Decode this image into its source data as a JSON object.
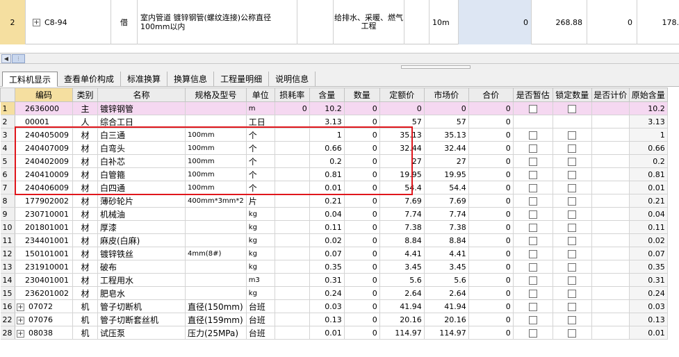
{
  "top_row": {
    "row_no": "2",
    "code": "C8-94",
    "type": "借",
    "name": "室内管道 镀锌钢管(螺纹连接)公称直径100mm以内",
    "major": "给排水、采暖、燃气工程",
    "unit": "10m",
    "quantity": "0",
    "unit_price": "268.88",
    "total": "0",
    "rest": "178."
  },
  "splitter_grip": "⁘",
  "tabs": [
    {
      "label": "工料机显示",
      "active": true
    },
    {
      "label": "查看单价构成"
    },
    {
      "label": "标准换算"
    },
    {
      "label": "换算信息"
    },
    {
      "label": "工程量明细"
    },
    {
      "label": "说明信息"
    }
  ],
  "columns": [
    "编码",
    "类别",
    "名称",
    "规格及型号",
    "单位",
    "损耗率",
    "含量",
    "数量",
    "定额价",
    "市场价",
    "合价",
    "是否暂估",
    "锁定数量",
    "是否计价",
    "原始含量"
  ],
  "rows": [
    {
      "no": "1",
      "code": "2636000",
      "cat": "主",
      "name": "镀锌钢管",
      "spec": "",
      "unit": "m",
      "loss": "0",
      "content": "10.2",
      "qty": "0",
      "price": "0",
      "market": "0",
      "sum": "0",
      "est": false,
      "lock": false,
      "orig": "10.2"
    },
    {
      "no": "2",
      "code": "00001",
      "cat": "人",
      "name": "综合工日",
      "spec": "",
      "unit": "工日",
      "loss": "",
      "content": "3.13",
      "qty": "0",
      "price": "57",
      "market": "57",
      "sum": "0",
      "est": null,
      "lock": null,
      "orig": "3.13"
    },
    {
      "no": "3",
      "code": "240405009",
      "cat": "材",
      "name": "白三通",
      "spec": "100mm",
      "unit": "个",
      "loss": "",
      "content": "1",
      "qty": "0",
      "price": "35.13",
      "market": "35.13",
      "sum": "0",
      "est": false,
      "lock": false,
      "orig": "1"
    },
    {
      "no": "4",
      "code": "240407009",
      "cat": "材",
      "name": "白弯头",
      "spec": "100mm",
      "unit": "个",
      "loss": "",
      "content": "0.66",
      "qty": "0",
      "price": "32.44",
      "market": "32.44",
      "sum": "0",
      "est": false,
      "lock": false,
      "orig": "0.66"
    },
    {
      "no": "5",
      "code": "240402009",
      "cat": "材",
      "name": "白补芯",
      "spec": "100mm",
      "unit": "个",
      "loss": "",
      "content": "0.2",
      "qty": "0",
      "price": "27",
      "market": "27",
      "sum": "0",
      "est": false,
      "lock": false,
      "orig": "0.2"
    },
    {
      "no": "6",
      "code": "240410009",
      "cat": "材",
      "name": "白管箍",
      "spec": "100mm",
      "unit": "个",
      "loss": "",
      "content": "0.81",
      "qty": "0",
      "price": "19.95",
      "market": "19.95",
      "sum": "0",
      "est": false,
      "lock": false,
      "orig": "0.81"
    },
    {
      "no": "7",
      "code": "240406009",
      "cat": "材",
      "name": "白四通",
      "spec": "100mm",
      "unit": "个",
      "loss": "",
      "content": "0.01",
      "qty": "0",
      "price": "54.4",
      "market": "54.4",
      "sum": "0",
      "est": false,
      "lock": false,
      "orig": "0.01"
    },
    {
      "no": "8",
      "code": "177902002",
      "cat": "材",
      "name": "薄砂轮片",
      "spec": "400mm*3mm*2",
      "unit": "片",
      "loss": "",
      "content": "0.21",
      "qty": "0",
      "price": "7.69",
      "market": "7.69",
      "sum": "0",
      "est": false,
      "lock": false,
      "orig": "0.21"
    },
    {
      "no": "9",
      "code": "230710001",
      "cat": "材",
      "name": "机械油",
      "spec": "",
      "unit": "kg",
      "loss": "",
      "content": "0.04",
      "qty": "0",
      "price": "7.74",
      "market": "7.74",
      "sum": "0",
      "est": false,
      "lock": false,
      "orig": "0.04"
    },
    {
      "no": "10",
      "code": "201801001",
      "cat": "材",
      "name": "厚漆",
      "spec": "",
      "unit": "kg",
      "loss": "",
      "content": "0.11",
      "qty": "0",
      "price": "7.38",
      "market": "7.38",
      "sum": "0",
      "est": false,
      "lock": false,
      "orig": "0.11"
    },
    {
      "no": "11",
      "code": "234401001",
      "cat": "材",
      "name": "麻皮(白麻)",
      "spec": "",
      "unit": "kg",
      "loss": "",
      "content": "0.02",
      "qty": "0",
      "price": "8.84",
      "market": "8.84",
      "sum": "0",
      "est": false,
      "lock": false,
      "orig": "0.02"
    },
    {
      "no": "12",
      "code": "150101001",
      "cat": "材",
      "name": "镀锌铁丝",
      "spec": "4mm(8#)",
      "unit": "kg",
      "loss": "",
      "content": "0.07",
      "qty": "0",
      "price": "4.41",
      "market": "4.41",
      "sum": "0",
      "est": false,
      "lock": false,
      "orig": "0.07"
    },
    {
      "no": "13",
      "code": "231910001",
      "cat": "材",
      "name": "破布",
      "spec": "",
      "unit": "kg",
      "loss": "",
      "content": "0.35",
      "qty": "0",
      "price": "3.45",
      "market": "3.45",
      "sum": "0",
      "est": false,
      "lock": false,
      "orig": "0.35"
    },
    {
      "no": "14",
      "code": "230401001",
      "cat": "材",
      "name": "工程用水",
      "spec": "",
      "unit": "m3",
      "loss": "",
      "content": "0.31",
      "qty": "0",
      "price": "5.6",
      "market": "5.6",
      "sum": "0",
      "est": false,
      "lock": false,
      "orig": "0.31"
    },
    {
      "no": "15",
      "code": "236201002",
      "cat": "材",
      "name": "肥皂水",
      "spec": "",
      "unit": "kg",
      "loss": "",
      "content": "0.24",
      "qty": "0",
      "price": "2.64",
      "market": "2.64",
      "sum": "0",
      "est": false,
      "lock": false,
      "orig": "0.24"
    },
    {
      "no": "16",
      "expand": true,
      "code": "07072",
      "cat": "机",
      "name": "管子切断机",
      "spec": "直径(150mm)",
      "spec_big": true,
      "unit": "台班",
      "loss": "",
      "content": "0.03",
      "qty": "0",
      "price": "41.94",
      "market": "41.94",
      "sum": "0",
      "est": false,
      "lock": false,
      "orig": "0.03"
    },
    {
      "no": "22",
      "expand": true,
      "code": "07076",
      "cat": "机",
      "name": "管子切断套丝机",
      "spec": "直径(159mm)",
      "spec_big": true,
      "unit": "台班",
      "loss": "",
      "content": "0.13",
      "qty": "0",
      "price": "20.16",
      "market": "20.16",
      "sum": "0",
      "est": false,
      "lock": false,
      "orig": "0.13"
    },
    {
      "no": "28",
      "expand": true,
      "code": "08038",
      "cat": "机",
      "name": "试压泵",
      "spec": "压力(25MPa)",
      "spec_big": true,
      "unit": "台班",
      "loss": "",
      "content": "0.01",
      "qty": "0",
      "price": "114.97",
      "market": "114.97",
      "sum": "0",
      "est": false,
      "lock": false,
      "orig": "0.01"
    }
  ],
  "colors": {
    "header_code": "#f5dfa0",
    "row_highlight": "#f5d8f1",
    "selected_cell": "#dde6f3",
    "annotation_box": "#e0161c"
  }
}
